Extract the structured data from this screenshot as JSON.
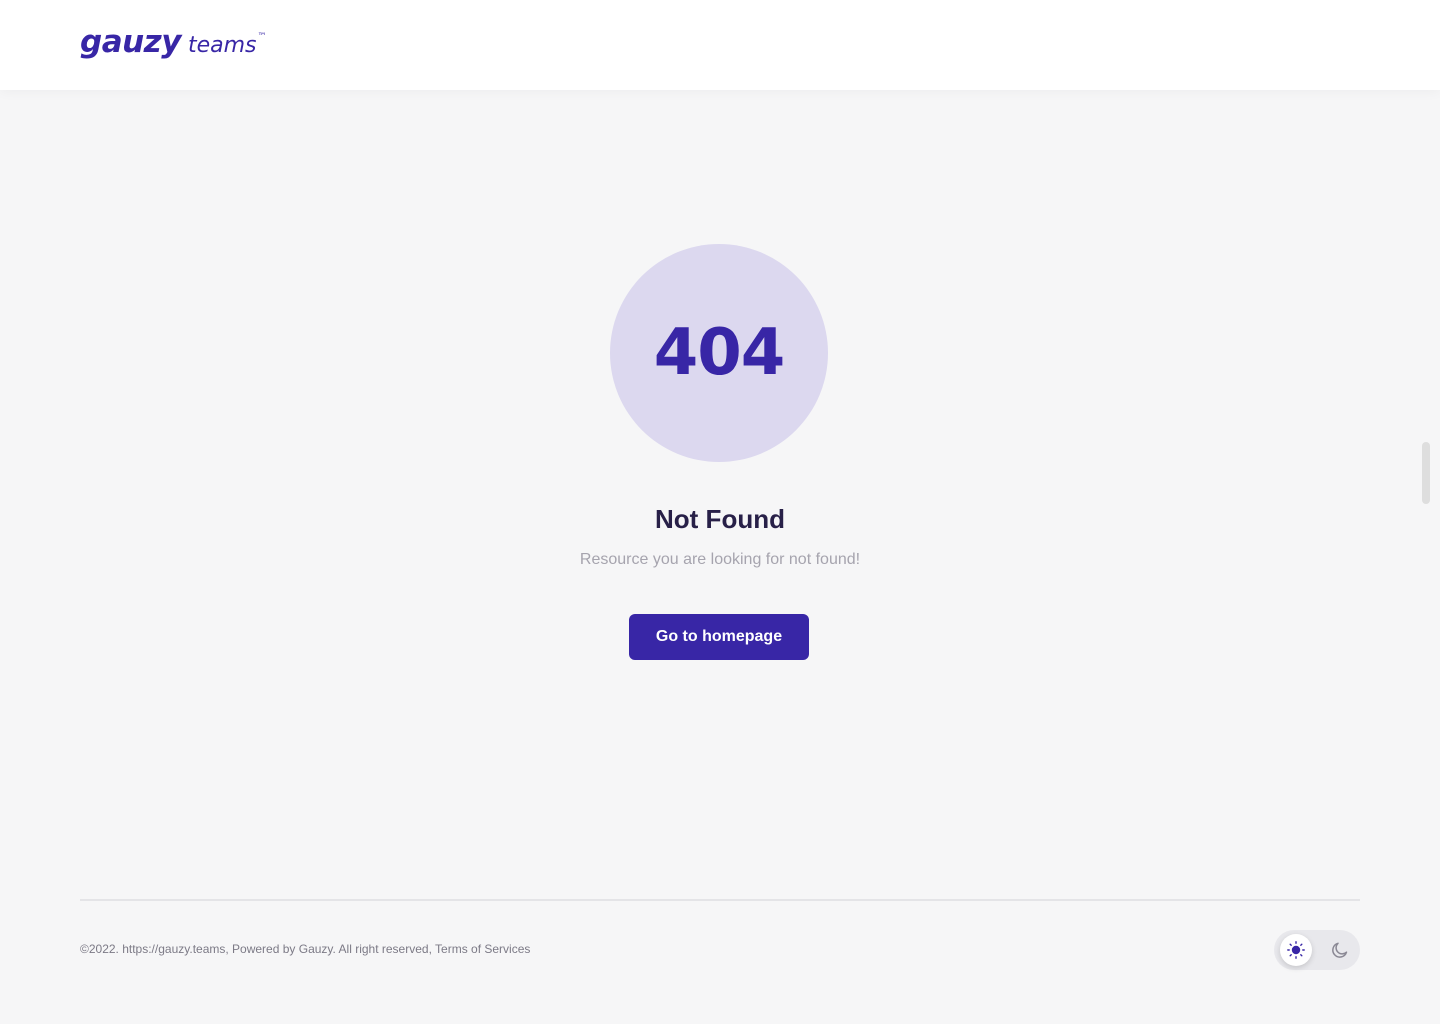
{
  "header": {
    "logo_word": "gauzy",
    "logo_sub": "teams",
    "logo_tm": "™"
  },
  "error": {
    "code": "404",
    "title": "Not Found",
    "message": "Resource you are looking for not found!",
    "button_label": "Go to homepage"
  },
  "footer": {
    "copyright": "©2022. https://gauzy.teams, Powered by Gauzy. All right reserved, ",
    "terms_link": "Terms of Services"
  },
  "theme_toggle": {
    "light_icon": "sun-icon",
    "dark_icon": "moon-icon",
    "selected": "light"
  },
  "colors": {
    "brand": "#3826a6",
    "circle_bg": "#dcd8ef",
    "page_bg": "#f6f6f7",
    "title": "#282048",
    "muted": "#a6a4ae"
  }
}
